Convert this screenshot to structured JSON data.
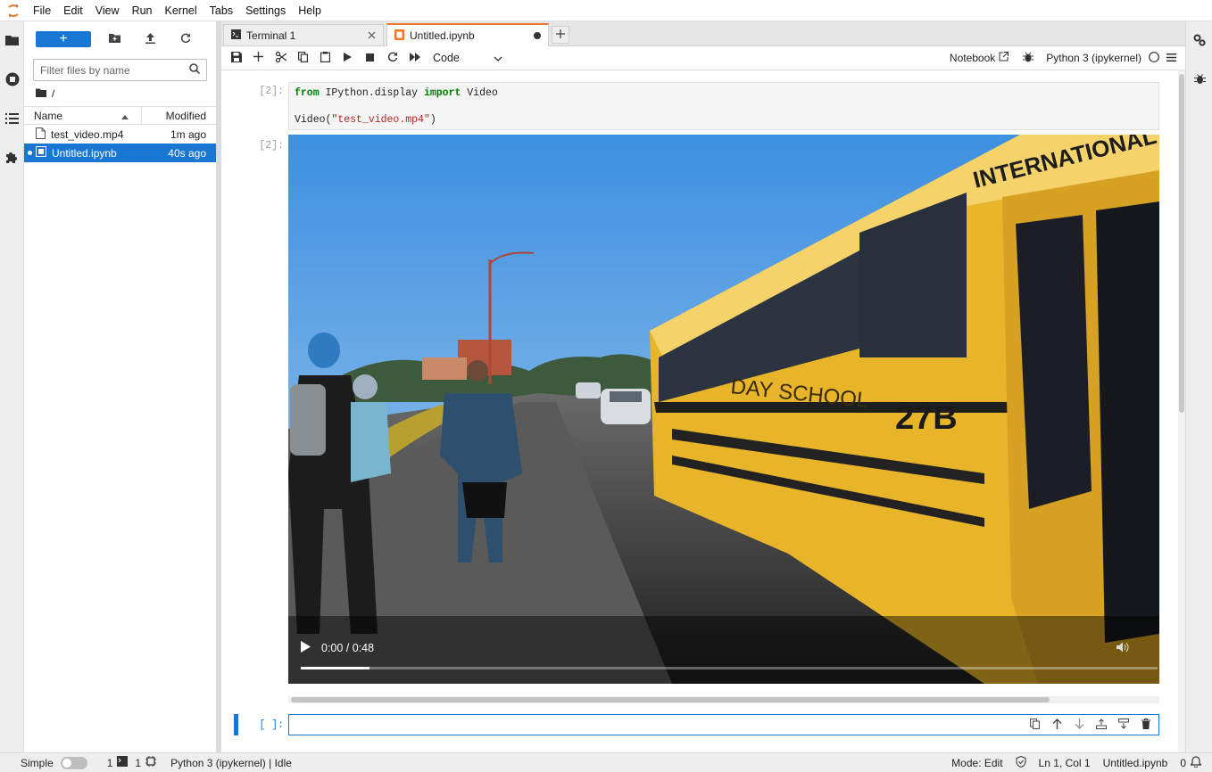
{
  "menubar": {
    "items": [
      "File",
      "Edit",
      "View",
      "Run",
      "Kernel",
      "Tabs",
      "Settings",
      "Help"
    ]
  },
  "filebrowser": {
    "new_label": "+",
    "filter_placeholder": "Filter files by name",
    "breadcrumb": "/",
    "columns": {
      "name": "Name",
      "modified": "Modified"
    },
    "files": [
      {
        "name": "test_video.mp4",
        "modified": "1m ago",
        "icon": "file-icon",
        "selected": false
      },
      {
        "name": "Untitled.ipynb",
        "modified": "40s ago",
        "icon": "notebook-icon",
        "selected": true
      }
    ]
  },
  "tabs": [
    {
      "title": "Terminal 1",
      "icon": "terminal-icon"
    },
    {
      "title": "Untitled.ipynb",
      "icon": "notebook-icon",
      "active": true,
      "dirty": true
    }
  ],
  "notebook_toolbar": {
    "cell_type": "Code",
    "notebook_link": "Notebook",
    "kernel_name": "Python 3 (ipykernel)"
  },
  "cells": {
    "cell1_prompt": "[2]:",
    "cell1_line1_kw1": "from",
    "cell1_line1_mod": " IPython.display ",
    "cell1_line1_kw2": "import",
    "cell1_line1_name": " Video",
    "cell1_line3_fn": "Video(",
    "cell1_line3_str": "\"test_video.mp4\"",
    "cell1_line3_end": ")",
    "cell2_prompt": "[2]:",
    "cell3_prompt": "[ ]:"
  },
  "video": {
    "time": "0:00 / 0:48",
    "progress": 0.08,
    "bus_lettering": "INTERNATIONAL",
    "bus_text": "DAY SCHOOL",
    "bus_number": "27B"
  },
  "statusbar": {
    "mode_label": "Simple",
    "terminals_count": "1",
    "kernels_count": "1",
    "kernel_status": "Python 3 (ipykernel) | Idle",
    "edit_mode": "Mode: Edit",
    "cursor": "Ln 1, Col 1",
    "filename": "Untitled.ipynb",
    "notifications": "0"
  },
  "colors": {
    "accent": "#1976d2",
    "tab_highlight": "#f37726"
  }
}
